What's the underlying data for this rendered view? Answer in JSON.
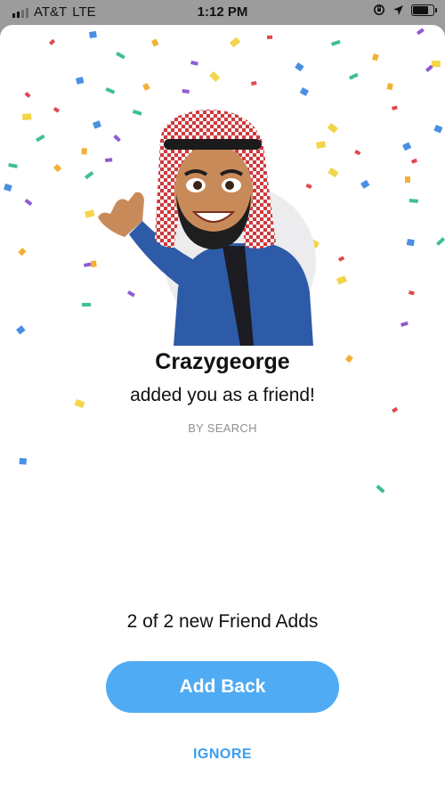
{
  "status_bar": {
    "carrier": "AT&T",
    "network": "LTE",
    "time": "1:12 PM",
    "signal_bars": 2,
    "battery_level": 0.85
  },
  "friend_card": {
    "username": "Crazygeorge",
    "message": "added you as a friend!",
    "source": "BY SEARCH",
    "avatar_icon": "bitmoji-avatar"
  },
  "friend_adds": {
    "counter": "2 of 2 new Friend Adds"
  },
  "actions": {
    "add_back_label": "Add Back",
    "ignore_label": "IGNORE"
  },
  "colors": {
    "accent": "#4fabf3",
    "ignore_text": "#3d9ef0",
    "confetti": [
      "#e2474b",
      "#4a90e2",
      "#3fbf8f",
      "#f2b134",
      "#8e5bd0",
      "#f2d54a"
    ]
  }
}
